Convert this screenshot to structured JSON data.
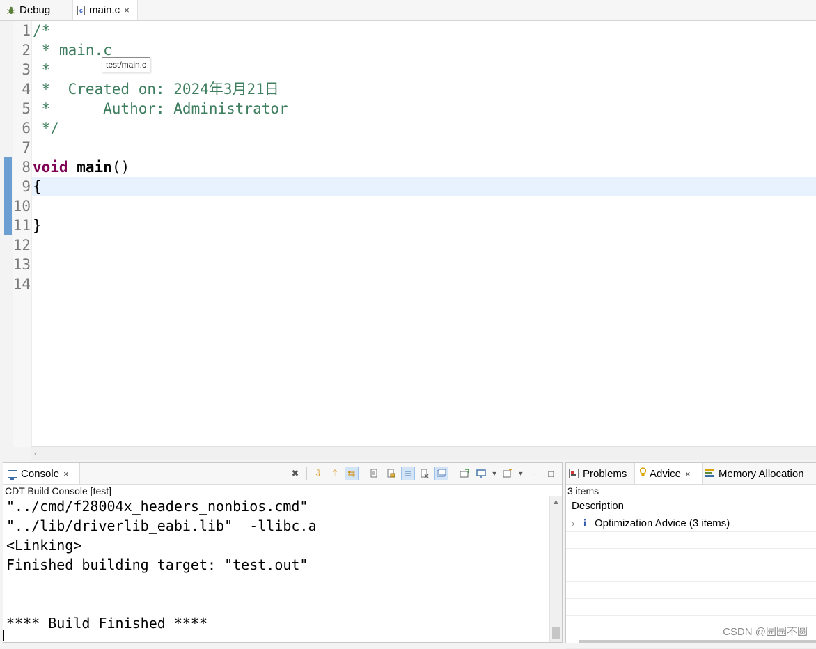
{
  "editor_tabs": [
    {
      "label": "Debug"
    },
    {
      "label": "main.c",
      "close": "×"
    }
  ],
  "editor": {
    "tooltip": "test/main.c",
    "lines": [
      {
        "n": "1",
        "t": "/*"
      },
      {
        "n": "2",
        "t": " * main.c"
      },
      {
        "n": "3",
        "t": " *"
      },
      {
        "n": "4",
        "t": " *  Created on: 2024年3月21日"
      },
      {
        "n": "5",
        "t": " *      Author: Administrator"
      },
      {
        "n": "6",
        "t": " */"
      },
      {
        "n": "7",
        "t": ""
      },
      {
        "n": "8",
        "kw": "void",
        "ident": "main",
        "rest": "()"
      },
      {
        "n": "9",
        "t": "{"
      },
      {
        "n": "10",
        "t": ""
      },
      {
        "n": "11",
        "t": "}"
      },
      {
        "n": "12",
        "t": ""
      },
      {
        "n": "13",
        "t": ""
      },
      {
        "n": "14",
        "t": ""
      }
    ],
    "scroll_arrow": "‹"
  },
  "console": {
    "tab_label": "Console",
    "tab_close": "×",
    "subtitle": "CDT Build Console [test]",
    "output_lines": [
      "\"../cmd/f28004x_headers_nonbios.cmd\"",
      "\"../lib/driverlib_eabi.lib\"  -llibc.a",
      "<Linking>",
      "Finished building target: \"test.out\"",
      "",
      "",
      "**** Build Finished ****"
    ],
    "toolbar": {
      "clear": "✖",
      "next": "⇩",
      "prev": "⇧",
      "link": "⇆",
      "minimize": "−",
      "maximize": "□"
    }
  },
  "right_panel": {
    "tabs": {
      "problems": "Problems",
      "advice": "Advice",
      "advice_close": "×",
      "memory": "Memory Allocation"
    },
    "count": "3 items",
    "column_header": "Description",
    "rows": [
      {
        "expand": "›",
        "icon": "i",
        "text": "Optimization Advice (3 items)"
      }
    ]
  },
  "watermark": "CSDN @园园不圆",
  "colors": {
    "comment": "#3f7f5f",
    "keyword": "#7f0055",
    "current_line": "#e8f2fe",
    "change_marker": "#6b9fd1"
  }
}
